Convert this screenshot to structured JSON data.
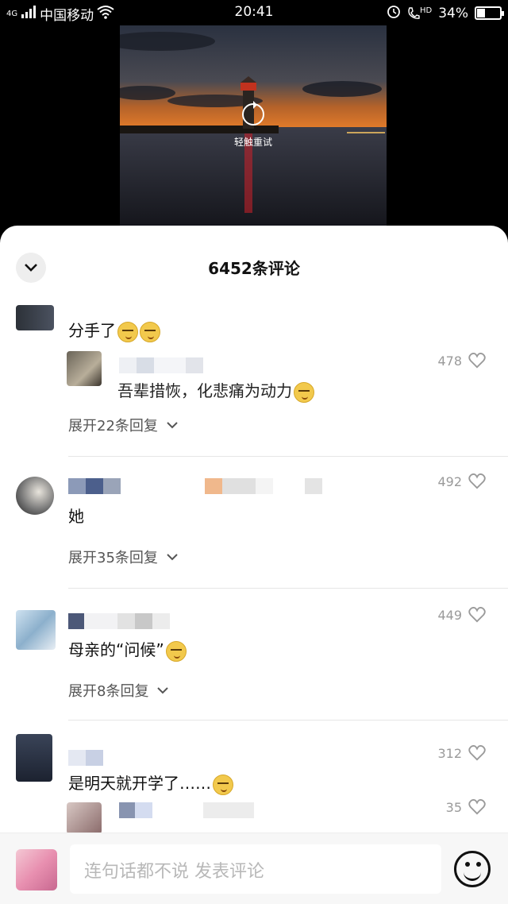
{
  "status_bar": {
    "network": "4G",
    "carrier": "中国移动",
    "time": "20:41",
    "hd": "HD",
    "battery": "34%",
    "battery_level": 0.34
  },
  "video": {
    "retry_label": "轻触重试"
  },
  "sheet": {
    "title": "6452条评论"
  },
  "comments": [
    {
      "text": "分手了",
      "reply": {
        "likes": "478",
        "text": "吾辈措恢，化悲痛为动力"
      },
      "expand_label": "展开22条回复"
    },
    {
      "likes": "492",
      "text": "她",
      "expand_label": "展开35条回复"
    },
    {
      "likes": "449",
      "text": "母亲的“问候”",
      "expand_label": "展开8条回复"
    },
    {
      "likes": "312",
      "text": "是明天就开学了……",
      "reply": {
        "likes": "35"
      }
    }
  ],
  "composer": {
    "placeholder": "连句话都不说 发表评论"
  },
  "colors": {
    "sheet_bg": "#ffffff",
    "likes_gray": "#9a9a9a",
    "composer_bg": "#f7f7f7"
  },
  "icons": [
    "signal-icon",
    "wifi-icon",
    "alarm-icon",
    "call-hd-icon",
    "battery-icon",
    "retry-icon",
    "chevron-down-icon",
    "heart-icon",
    "emoji-icon"
  ]
}
